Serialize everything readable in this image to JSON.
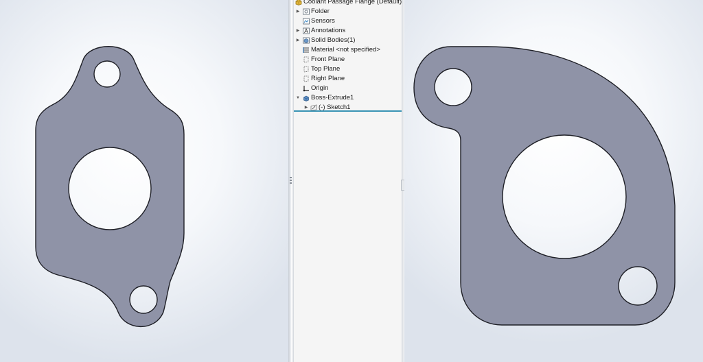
{
  "feature_tree": {
    "part_name": "Coolant Passage Flange (Default) <<",
    "items": [
      {
        "label": "Folder",
        "icon": "folder-icon",
        "expandable": true
      },
      {
        "label": "Sensors",
        "icon": "sensors-icon",
        "expandable": false
      },
      {
        "label": "Annotations",
        "icon": "annotations-icon",
        "expandable": true
      },
      {
        "label": "Solid Bodies(1)",
        "icon": "solid-bodies-icon",
        "expandable": true
      },
      {
        "label": "Material <not specified>",
        "icon": "material-icon",
        "expandable": false
      },
      {
        "label": "Front Plane",
        "icon": "plane-icon",
        "expandable": false
      },
      {
        "label": "Top Plane",
        "icon": "plane-icon",
        "expandable": false
      },
      {
        "label": "Right Plane",
        "icon": "plane-icon",
        "expandable": false
      },
      {
        "label": "Origin",
        "icon": "origin-icon",
        "expandable": false
      },
      {
        "label": "Boss-Extrude1",
        "icon": "boss-extrude-icon",
        "expandable": true,
        "expanded": true
      },
      {
        "label": "(-) Sketch1",
        "icon": "sketch-icon",
        "expandable": true,
        "child": true
      }
    ]
  },
  "colors": {
    "part_fill": "#8f93a7",
    "part_edge": "#1e1f26",
    "selection_line": "#3a93b4"
  }
}
